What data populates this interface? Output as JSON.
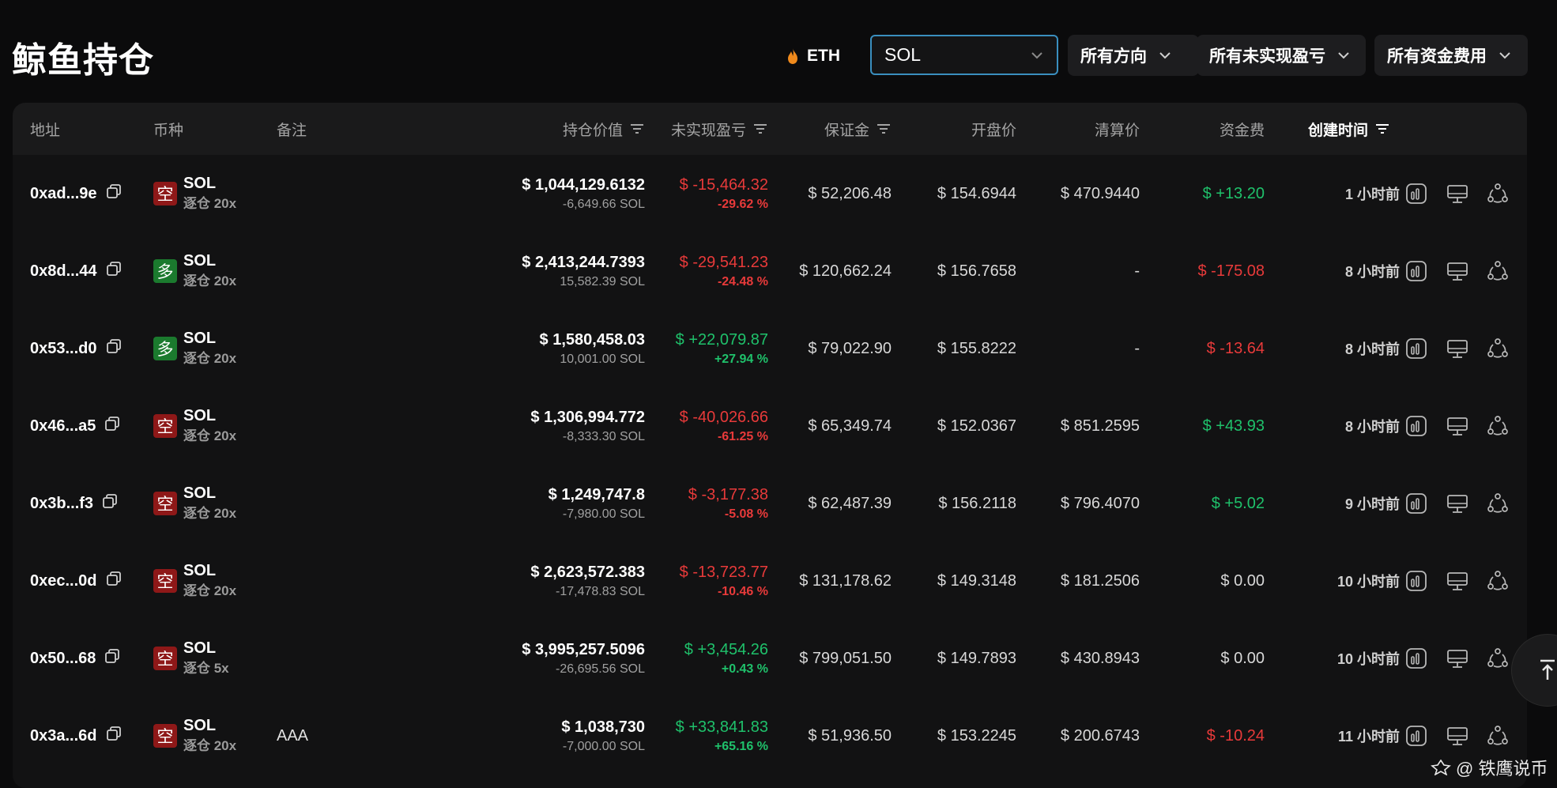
{
  "title": "鲸鱼持仓",
  "filters": {
    "eth_label": "ETH",
    "search_value": "SOL",
    "direction": "所有方向",
    "pnl": "所有未实现盈亏",
    "funding": "所有资金费用"
  },
  "columns": {
    "address": "地址",
    "coin": "币种",
    "note": "备注",
    "value": "持仓价值",
    "pnl": "未实现盈亏",
    "margin": "保证金",
    "entry": "开盘价",
    "liq": "清算价",
    "funding": "资金费",
    "created": "创建时间"
  },
  "rows": [
    {
      "address": "0xad...9e",
      "side": "空",
      "side_type": "short",
      "coin": "SOL",
      "leverage": "逐仓 20x",
      "note": "",
      "value": "$ 1,044,129.6132",
      "size": "-6,649.66 SOL",
      "pnl": "$ -15,464.32",
      "pnl_pct": "-29.62 %",
      "pnl_sign": "neg",
      "margin": "$ 52,206.48",
      "entry": "$ 154.6944",
      "liq": "$ 470.9440",
      "funding": "$ +13.20",
      "funding_sign": "pos",
      "time": "1 小时前"
    },
    {
      "address": "0x8d...44",
      "side": "多",
      "side_type": "long",
      "coin": "SOL",
      "leverage": "逐仓 20x",
      "note": "",
      "value": "$ 2,413,244.7393",
      "size": "15,582.39 SOL",
      "pnl": "$ -29,541.23",
      "pnl_pct": "-24.48 %",
      "pnl_sign": "neg",
      "margin": "$ 120,662.24",
      "entry": "$ 156.7658",
      "liq": "-",
      "funding": "$ -175.08",
      "funding_sign": "neg",
      "time": "8 小时前"
    },
    {
      "address": "0x53...d0",
      "side": "多",
      "side_type": "long",
      "coin": "SOL",
      "leverage": "逐仓 20x",
      "note": "",
      "value": "$ 1,580,458.03",
      "size": "10,001.00 SOL",
      "pnl": "$ +22,079.87",
      "pnl_pct": "+27.94 %",
      "pnl_sign": "pos",
      "margin": "$ 79,022.90",
      "entry": "$ 155.8222",
      "liq": "-",
      "funding": "$ -13.64",
      "funding_sign": "neg",
      "time": "8 小时前"
    },
    {
      "address": "0x46...a5",
      "side": "空",
      "side_type": "short",
      "coin": "SOL",
      "leverage": "逐仓 20x",
      "note": "",
      "value": "$ 1,306,994.772",
      "size": "-8,333.30 SOL",
      "pnl": "$ -40,026.66",
      "pnl_pct": "-61.25 %",
      "pnl_sign": "neg",
      "margin": "$ 65,349.74",
      "entry": "$ 152.0367",
      "liq": "$ 851.2595",
      "funding": "$ +43.93",
      "funding_sign": "pos",
      "time": "8 小时前"
    },
    {
      "address": "0x3b...f3",
      "side": "空",
      "side_type": "short",
      "coin": "SOL",
      "leverage": "逐仓 20x",
      "note": "",
      "value": "$ 1,249,747.8",
      "size": "-7,980.00 SOL",
      "pnl": "$ -3,177.38",
      "pnl_pct": "-5.08 %",
      "pnl_sign": "neg",
      "margin": "$ 62,487.39",
      "entry": "$ 156.2118",
      "liq": "$ 796.4070",
      "funding": "$ +5.02",
      "funding_sign": "pos",
      "time": "9 小时前"
    },
    {
      "address": "0xec...0d",
      "side": "空",
      "side_type": "short",
      "coin": "SOL",
      "leverage": "逐仓 20x",
      "note": "",
      "value": "$ 2,623,572.383",
      "size": "-17,478.83 SOL",
      "pnl": "$ -13,723.77",
      "pnl_pct": "-10.46 %",
      "pnl_sign": "neg",
      "margin": "$ 131,178.62",
      "entry": "$ 149.3148",
      "liq": "$ 181.2506",
      "funding": "$ 0.00",
      "funding_sign": "plain",
      "time": "10 小时前"
    },
    {
      "address": "0x50...68",
      "side": "空",
      "side_type": "short",
      "coin": "SOL",
      "leverage": "逐仓 5x",
      "note": "",
      "value": "$ 3,995,257.5096",
      "size": "-26,695.56 SOL",
      "pnl": "$ +3,454.26",
      "pnl_pct": "+0.43 %",
      "pnl_sign": "pos",
      "margin": "$ 799,051.50",
      "entry": "$ 149.7893",
      "liq": "$ 430.8943",
      "funding": "$ 0.00",
      "funding_sign": "plain",
      "time": "10 小时前"
    },
    {
      "address": "0x3a...6d",
      "side": "空",
      "side_type": "short",
      "coin": "SOL",
      "leverage": "逐仓 20x",
      "note": "AAA",
      "value": "$ 1,038,730",
      "size": "-7,000.00 SOL",
      "pnl": "$ +33,841.83",
      "pnl_pct": "+65.16 %",
      "pnl_sign": "pos",
      "margin": "$ 51,936.50",
      "entry": "$ 153.2245",
      "liq": "$ 200.6743",
      "funding": "$ -10.24",
      "funding_sign": "neg",
      "time": "11 小时前"
    }
  ],
  "watermark": "@ 铁鹰说币",
  "colors": {
    "positive": "#1fc16b",
    "negative": "#e83a3a",
    "short_badge": "#8e1818",
    "long_badge": "#1b7a2e",
    "search_border": "#3a8fbf"
  }
}
